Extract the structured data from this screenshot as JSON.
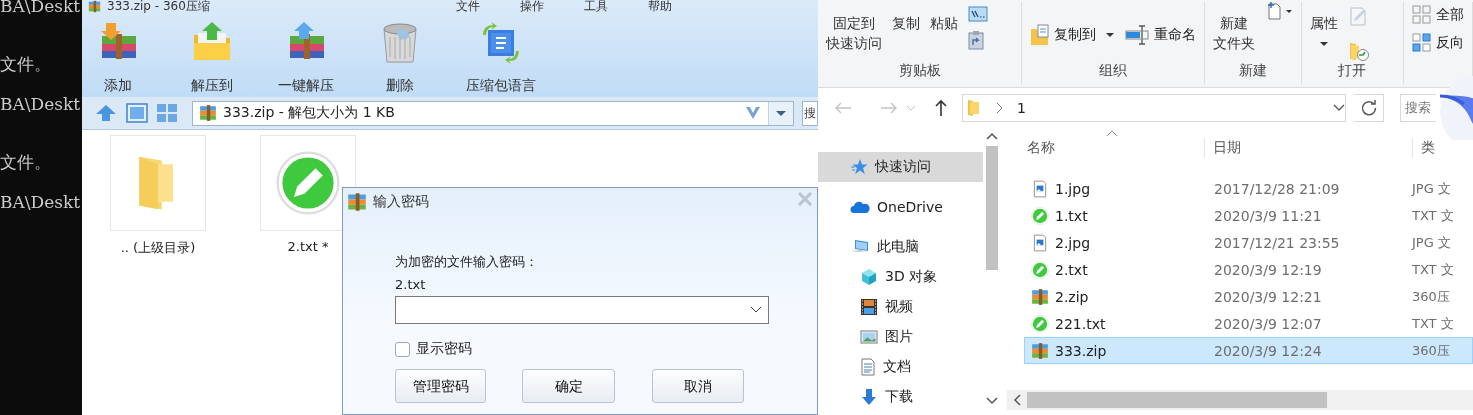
{
  "terminal": {
    "lines": [
      "BA\\Deskt",
      "文件。",
      "BA\\Deskt",
      "文件。",
      "BA\\Deskt"
    ]
  },
  "archive_window": {
    "title": "333.zip - 360压缩",
    "menu": [
      "文件",
      "操作",
      "工具",
      "帮助"
    ],
    "toolbar": [
      {
        "label": "添加",
        "kind": "add"
      },
      {
        "label": "解压到",
        "kind": "extract"
      },
      {
        "label": "一键解压",
        "kind": "quick-extract"
      },
      {
        "label": "删除",
        "kind": "delete"
      },
      {
        "label": "压缩包语言",
        "kind": "language"
      }
    ],
    "address": "333.zip - 解包大小为 1 KB",
    "search_placeholder": "搜",
    "files": [
      {
        "name": ".. (上级目录)",
        "kind": "folder"
      },
      {
        "name": "2.txt *",
        "kind": "text"
      }
    ]
  },
  "password_dialog": {
    "title": "输入密码",
    "prompt": "为加密的文件输入密码：",
    "file": "2.txt",
    "show_password": {
      "label": "显示密码",
      "checked": false
    },
    "buttons": [
      "管理密码",
      "确定",
      "取消"
    ]
  },
  "explorer": {
    "ribbon": [
      {
        "label": "剪贴板",
        "columns": [
          [
            {
              "kind": "big",
              "lines": [
                "固定到",
                "快速访问"
              ]
            }
          ],
          [
            {
              "kind": "big",
              "lines": [
                "复制"
              ]
            }
          ],
          [
            {
              "kind": "big",
              "lines": [
                "粘贴"
              ]
            }
          ],
          [
            {
              "kind": "icon"
            },
            {
              "kind": "icon"
            }
          ]
        ]
      },
      {
        "label": "组织",
        "columns": [
          [
            {
              "kind": "small",
              "label": "复制到",
              "caret": true
            }
          ],
          [
            {
              "kind": "small",
              "label": "重命名",
              "caret": false
            }
          ]
        ]
      },
      {
        "label": "新建",
        "columns": [
          [
            {
              "kind": "big",
              "lines": [
                "新建",
                "文件夹"
              ]
            }
          ],
          [
            {
              "kind": "icon"
            }
          ]
        ]
      },
      {
        "label": "打开",
        "columns": [
          [
            {
              "kind": "big",
              "lines": [
                "属性"
              ],
              "caret": true
            }
          ],
          [
            {
              "kind": "icon"
            },
            {
              "kind": "icon"
            }
          ]
        ]
      },
      {
        "columns": [
          [
            {
              "kind": "small",
              "label": "全部",
              "caret": false
            },
            {
              "kind": "small",
              "label": "反向",
              "caret": false
            }
          ]
        ]
      }
    ],
    "address": "1",
    "search_placeholder": "搜索",
    "sidebar": [
      {
        "label": "快速访问",
        "kind": "star",
        "selected": true
      },
      {
        "label": "OneDrive",
        "kind": "cloud",
        "selected": false
      },
      {
        "label": "此电脑",
        "kind": "computer",
        "selected": false,
        "children": [
          {
            "label": "3D 对象",
            "kind": "cube",
            "selected": false
          },
          {
            "label": "视频",
            "kind": "film",
            "selected": false
          },
          {
            "label": "图片",
            "kind": "picture",
            "selected": false
          },
          {
            "label": "文档",
            "kind": "document",
            "selected": false
          },
          {
            "label": "下载",
            "kind": "download",
            "selected": false
          }
        ]
      }
    ],
    "columns": [
      "名称",
      "日期",
      "类"
    ],
    "files": [
      {
        "name": "1.jpg",
        "kind": "image",
        "date": "2017/12/28 21:09",
        "type": "JPG 文",
        "selected": false
      },
      {
        "name": "1.txt",
        "kind": "text",
        "date": "2020/3/9 11:21",
        "type": "TXT 文",
        "selected": false
      },
      {
        "name": "2.jpg",
        "kind": "image",
        "date": "2017/12/21 23:55",
        "type": "JPG 文",
        "selected": false
      },
      {
        "name": "2.txt",
        "kind": "text",
        "date": "2020/3/9 12:19",
        "type": "TXT 文",
        "selected": false
      },
      {
        "name": "2.zip",
        "kind": "archive",
        "date": "2020/3/9 12:21",
        "type": "360压",
        "selected": false
      },
      {
        "name": "221.txt",
        "kind": "text",
        "date": "2020/3/9 12:07",
        "type": "TXT 文",
        "selected": false
      },
      {
        "name": "333.zip",
        "kind": "archive",
        "date": "2020/3/9 12:24",
        "type": "360压",
        "selected": true
      }
    ]
  }
}
